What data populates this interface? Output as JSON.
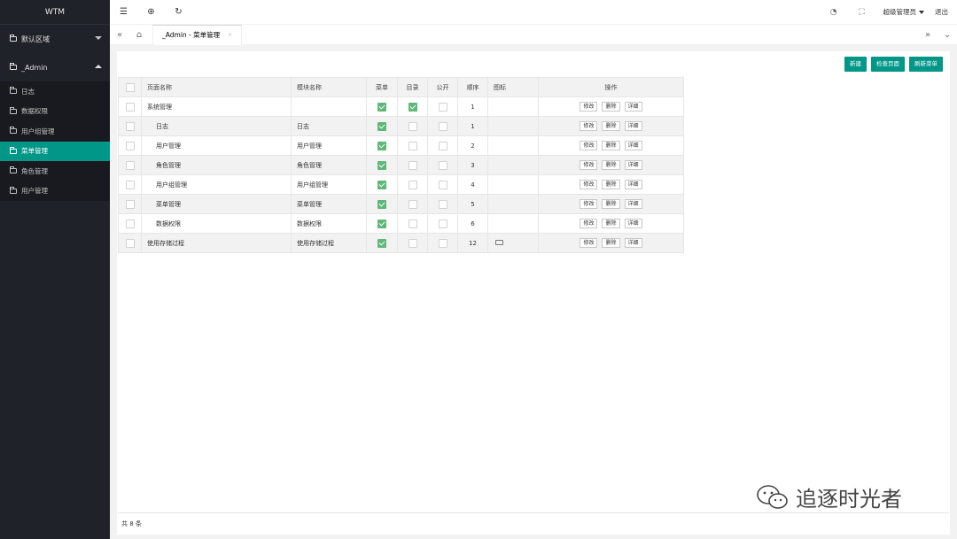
{
  "app": {
    "title": "WTM"
  },
  "sidebar": {
    "groups": [
      {
        "label": "默认区域",
        "expanded": false
      },
      {
        "label": "_Admin",
        "expanded": true
      }
    ],
    "items": [
      {
        "label": "日志",
        "active": false
      },
      {
        "label": "数据权限",
        "active": false
      },
      {
        "label": "用户组管理",
        "active": false
      },
      {
        "label": "菜单管理",
        "active": true
      },
      {
        "label": "角色管理",
        "active": false
      },
      {
        "label": "用户管理",
        "active": false
      }
    ]
  },
  "header": {
    "icons": [
      "menu-icon",
      "globe-icon",
      "refresh-icon"
    ],
    "right_icons": [
      "theme-icon",
      "fullscreen-icon"
    ],
    "user": "超级管理员",
    "logout": "退出"
  },
  "tabs": {
    "items": [
      {
        "label": "_Admin - 菜单管理",
        "close": "×"
      }
    ]
  },
  "toolbar": {
    "new": "新建",
    "check_page": "检查页面",
    "refresh_menu": "刷新菜单"
  },
  "table": {
    "headers": [
      "页面名称",
      "模块名称",
      "菜单",
      "目录",
      "公开",
      "顺序",
      "图标",
      "操作"
    ],
    "rows": [
      {
        "name": "系统管理",
        "module": "",
        "menu": true,
        "folder": true,
        "public": false,
        "order": "1",
        "icon": "",
        "indent": false
      },
      {
        "name": "日志",
        "module": "日志",
        "menu": true,
        "folder": false,
        "public": false,
        "order": "1",
        "icon": "",
        "indent": true
      },
      {
        "name": "用户管理",
        "module": "用户管理",
        "menu": true,
        "folder": false,
        "public": false,
        "order": "2",
        "icon": "",
        "indent": true
      },
      {
        "name": "角色管理",
        "module": "角色管理",
        "menu": true,
        "folder": false,
        "public": false,
        "order": "3",
        "icon": "",
        "indent": true
      },
      {
        "name": "用户组管理",
        "module": "用户组管理",
        "menu": true,
        "folder": false,
        "public": false,
        "order": "4",
        "icon": "",
        "indent": true
      },
      {
        "name": "菜单管理",
        "module": "菜单管理",
        "menu": true,
        "folder": false,
        "public": false,
        "order": "5",
        "icon": "",
        "indent": true
      },
      {
        "name": "数据权限",
        "module": "数据权限",
        "menu": true,
        "folder": false,
        "public": false,
        "order": "6",
        "icon": "",
        "indent": true
      },
      {
        "name": "使用存储过程",
        "module": "使用存储过程",
        "menu": true,
        "folder": false,
        "public": false,
        "order": "12",
        "icon": "monitor-icon",
        "indent": false
      }
    ],
    "actions": {
      "edit": "修改",
      "delete": "删除",
      "detail": "详细"
    }
  },
  "footer": {
    "count": "共 8 条"
  },
  "watermark": {
    "text": "追逐时光者"
  },
  "colors": {
    "accent": "#009688",
    "check": "#5fb878",
    "sidebar": "#20222a"
  }
}
